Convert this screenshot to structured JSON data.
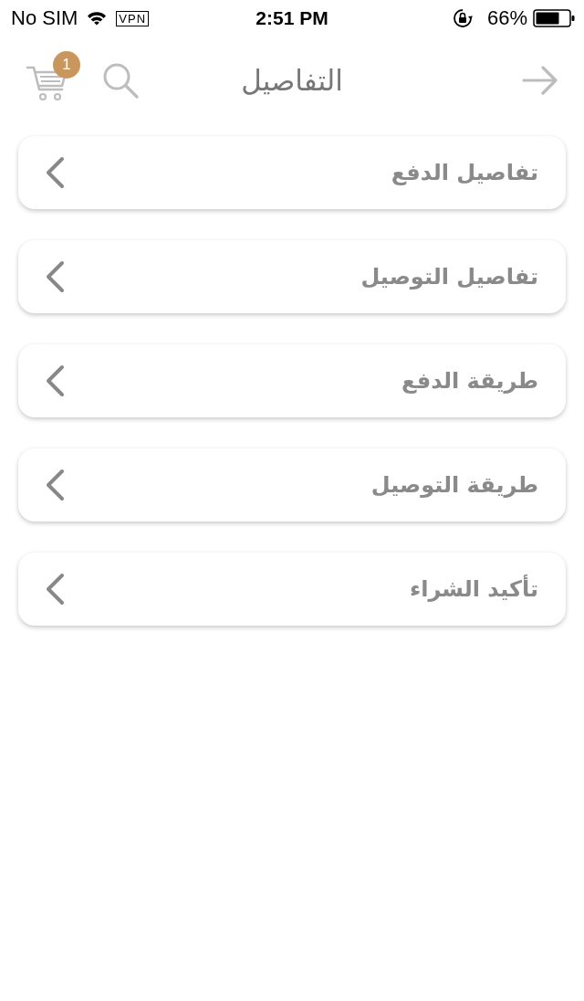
{
  "status_bar": {
    "carrier": "No SIM",
    "vpn": "VPN",
    "time": "2:51 PM",
    "battery": "66%"
  },
  "header": {
    "title": "التفاصيل",
    "cart_badge": "1"
  },
  "items": [
    {
      "label": "تفاصيل الدفع"
    },
    {
      "label": "تفاصيل التوصيل"
    },
    {
      "label": "طريقة الدفع"
    },
    {
      "label": "طريقة التوصيل"
    },
    {
      "label": "تأكيد الشراء"
    }
  ]
}
